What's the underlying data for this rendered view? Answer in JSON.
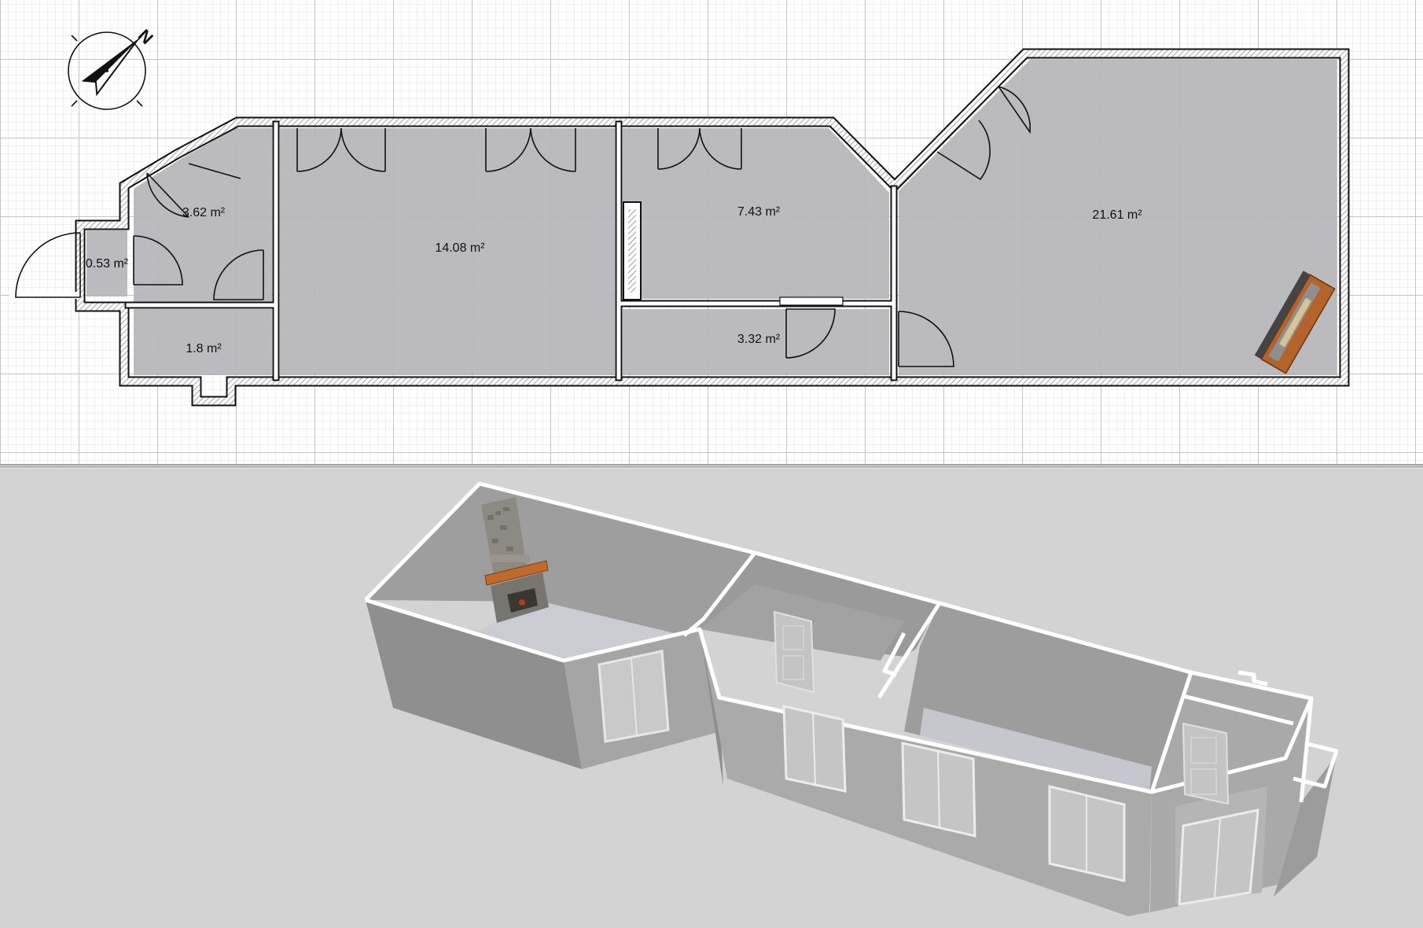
{
  "plan": {
    "compass_label": "N",
    "rooms": [
      {
        "id": "entry",
        "area": "3.62 m²"
      },
      {
        "id": "porch",
        "area": "0.53 m²"
      },
      {
        "id": "wc",
        "area": "1.8 m²"
      },
      {
        "id": "living",
        "area": "14.08 m²"
      },
      {
        "id": "bedroom",
        "area": "7.43 m²"
      },
      {
        "id": "bath",
        "area": "3.32 m²"
      },
      {
        "id": "main-room",
        "area": "21.61 m²"
      }
    ]
  },
  "colors": {
    "grid_bg": "#ffffff",
    "grid_fine": "#e3e3e3",
    "grid_major": "#c4c4c4",
    "room_fill": "#b4b4ba",
    "wall": "#111111",
    "view3d_bg": "#d3d3d3",
    "furniture_wood": "#b4642a"
  }
}
